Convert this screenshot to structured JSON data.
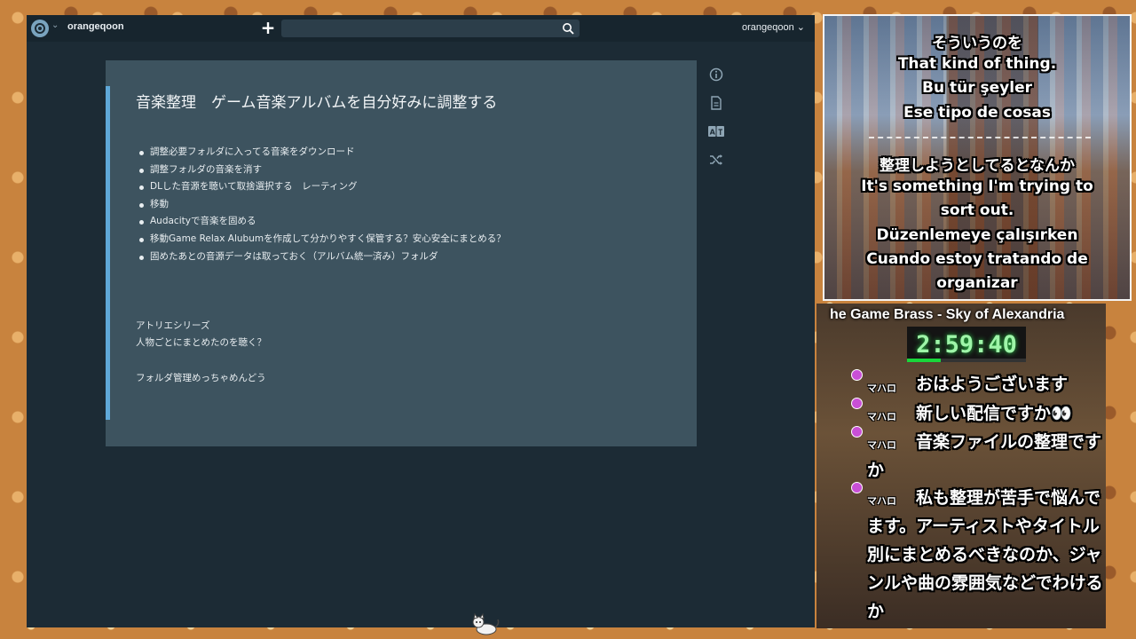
{
  "app": {
    "workspace_name": "orangeqoon",
    "user_menu_label": "orangeqoon ⌄",
    "search": {
      "placeholder": "",
      "value": ""
    }
  },
  "note": {
    "title": "音楽整理　ゲーム音楽アルバムを自分好みに調整する",
    "tasks": [
      "調整必要フォルダに入ってる音楽をダウンロード",
      "調整フォルダの音楽を消す",
      "DLした音源を聴いて取捨選択する　レーティング",
      "移動",
      "Audacityで音楽を固める",
      "移動Game Relax Alubumを作成して分かりやすく保管する？安心安全にまとめる？",
      "固めたあとの音源データは取っておく（アルバム統一済み）フォルダ"
    ],
    "line_1": "アトリエシリーズ",
    "line_2": "人物ごとにまとめたのを聴く？",
    "line_3": "フォルダ管理めっちゃめんどう"
  },
  "tools": [
    "info-icon",
    "document-icon",
    "translate-icon",
    "shuffle-icon"
  ],
  "subtitles": {
    "block_1": [
      "そういうのを",
      "That kind of thing.",
      "Bu tür şeyler",
      "Ese tipo de cosas"
    ],
    "block_2": [
      "整理しようとしてるとなんか",
      "It's something I'm trying to",
      "sort out.",
      "Düzenlemeye çalışırken",
      "Cuando estoy tratando de",
      "organizar"
    ]
  },
  "stream": {
    "now_playing": "he Game Brass - Sky of Alexandria",
    "timer": "2:59:40",
    "timer_progress_fraction": 0.28,
    "chat": [
      {
        "name": "マハロ",
        "text": "おはようございます"
      },
      {
        "name": "マハロ",
        "text": "新しい配信ですか👀"
      },
      {
        "name": "マハロ",
        "text": "音楽ファイルの整理ですか"
      },
      {
        "name": "マハロ",
        "text": "私も整理が苦手で悩んでます。アーティストやタイトル別にまとめるべきなのか、ジャンルや曲の雰囲気などでわけるか"
      }
    ]
  },
  "colors": {
    "accent": "#5fa8d8",
    "panel": "#3d535f",
    "app_bg": "#1c2b35",
    "timer_green": "#19d63b"
  }
}
